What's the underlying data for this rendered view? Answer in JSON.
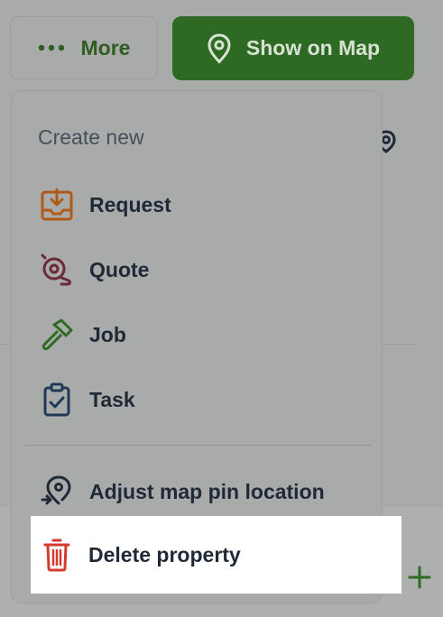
{
  "header": {
    "more_label": "More",
    "map_label": "Show on Map"
  },
  "menu": {
    "heading": "Create new",
    "items": [
      {
        "label": "Request",
        "icon": "inbox-download-icon",
        "color": "#b05a1a"
      },
      {
        "label": "Quote",
        "icon": "quote-tape-icon",
        "color": "#6b2a3a"
      },
      {
        "label": "Job",
        "icon": "hammer-icon",
        "color": "#2f6a24"
      },
      {
        "label": "Task",
        "icon": "clipboard-check-icon",
        "color": "#1f3a55"
      }
    ],
    "actions": [
      {
        "label": "Adjust map pin location",
        "icon": "map-pin-adjust-icon",
        "color": "#1f2a36"
      },
      {
        "label": "Delete property",
        "icon": "trash-icon",
        "color": "#d43b2e"
      }
    ]
  },
  "colors": {
    "accent_green": "#2f6a24",
    "danger_red": "#d43b2e",
    "overlay_gray": "#a9aaaa"
  }
}
